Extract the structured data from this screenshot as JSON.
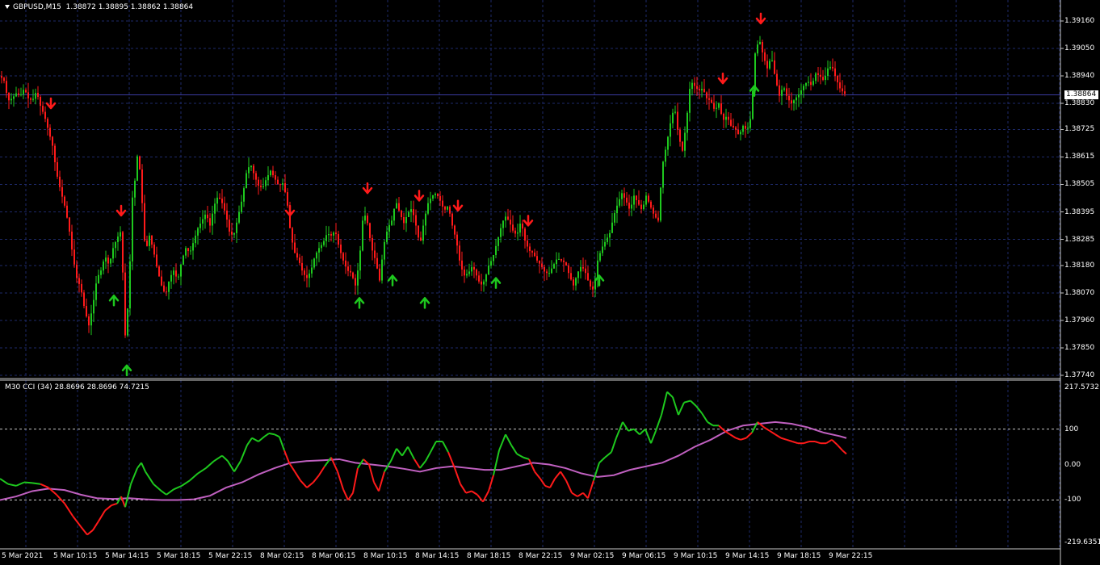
{
  "window": {
    "symbol_title": "GBPUSD,M15",
    "ohlc": "1.38872 1.38895 1.38862 1.38864",
    "current_price": "1.38864"
  },
  "indicator": {
    "label": "M30 CCI (34) 28.8696 28.8696 74.7215",
    "scale_max": "217.5732",
    "scale_min": "-219.6351",
    "levels": [
      "100",
      "0.00",
      "-100"
    ]
  },
  "price_axis": [
    "1.39160",
    "1.39050",
    "1.38940",
    "1.38830",
    "1.38725",
    "1.38615",
    "1.38505",
    "1.38395",
    "1.38285",
    "1.38180",
    "1.38070",
    "1.37960",
    "1.37850",
    "1.37740"
  ],
  "time_axis": [
    "5 Mar 2021",
    "5 Mar 10:15",
    "5 Mar 14:15",
    "5 Mar 18:15",
    "5 Mar 22:15",
    "8 Mar 02:15",
    "8 Mar 06:15",
    "8 Mar 10:15",
    "8 Mar 14:15",
    "8 Mar 18:15",
    "8 Mar 22:15",
    "9 Mar 02:15",
    "9 Mar 06:15",
    "9 Mar 10:15",
    "9 Mar 14:15",
    "9 Mar 18:15",
    "9 Mar 22:15"
  ],
  "colors": {
    "background": "#000000",
    "grid": "#1e2a6a",
    "bull": "#1ec81e",
    "bear": "#ff1a1a",
    "cci_signal": "#c060c0",
    "up_arrow": "#1ec81e",
    "down_arrow": "#ff1a1a"
  },
  "chart_data": {
    "type": "line",
    "price_path": [
      [
        0,
        1.3894
      ],
      [
        5,
        1.3892
      ],
      [
        10,
        1.3884
      ],
      [
        15,
        1.3885
      ],
      [
        20,
        1.3887
      ],
      [
        25,
        1.3886
      ],
      [
        30,
        1.3889
      ],
      [
        35,
        1.3885
      ],
      [
        40,
        1.3884
      ],
      [
        45,
        1.3888
      ],
      [
        50,
        1.3882
      ],
      [
        55,
        1.3878
      ],
      [
        60,
        1.3872
      ],
      [
        65,
        1.3866
      ],
      [
        70,
        1.3855
      ],
      [
        75,
        1.3848
      ],
      [
        80,
        1.3842
      ],
      [
        85,
        1.3834
      ],
      [
        90,
        1.3822
      ],
      [
        95,
        1.3813
      ],
      [
        100,
        1.3809
      ],
      [
        105,
        1.38
      ],
      [
        110,
        1.3794
      ],
      [
        115,
        1.3802
      ],
      [
        120,
        1.3813
      ],
      [
        125,
        1.3816
      ],
      [
        130,
        1.3822
      ],
      [
        135,
        1.3818
      ],
      [
        140,
        1.3825
      ],
      [
        145,
        1.3829
      ],
      [
        150,
        1.3832
      ],
      [
        155,
        1.379
      ],
      [
        160,
        1.3808
      ],
      [
        163,
        1.3843
      ],
      [
        167,
        1.3852
      ],
      [
        171,
        1.3865
      ],
      [
        175,
        1.3848
      ],
      [
        180,
        1.3823
      ],
      [
        185,
        1.383
      ],
      [
        190,
        1.3824
      ],
      [
        195,
        1.3816
      ],
      [
        200,
        1.381
      ],
      [
        205,
        1.3806
      ],
      [
        210,
        1.3813
      ],
      [
        215,
        1.3816
      ],
      [
        220,
        1.3812
      ],
      [
        225,
        1.382
      ],
      [
        230,
        1.3825
      ],
      [
        235,
        1.3823
      ],
      [
        240,
        1.3828
      ],
      [
        245,
        1.3833
      ],
      [
        250,
        1.3836
      ],
      [
        255,
        1.3839
      ],
      [
        260,
        1.3834
      ],
      [
        265,
        1.3842
      ],
      [
        270,
        1.3846
      ],
      [
        275,
        1.3843
      ],
      [
        280,
        1.3838
      ],
      [
        285,
        1.383
      ],
      [
        290,
        1.3831
      ],
      [
        295,
        1.3838
      ],
      [
        300,
        1.3845
      ],
      [
        305,
        1.3855
      ],
      [
        310,
        1.3859
      ],
      [
        315,
        1.3854
      ],
      [
        320,
        1.385
      ],
      [
        325,
        1.3849
      ],
      [
        330,
        1.3853
      ],
      [
        335,
        1.3856
      ],
      [
        340,
        1.3853
      ],
      [
        345,
        1.385
      ],
      [
        350,
        1.3851
      ],
      [
        355,
        1.3845
      ],
      [
        360,
        1.383
      ],
      [
        365,
        1.3823
      ],
      [
        370,
        1.382
      ],
      [
        375,
        1.3815
      ],
      [
        380,
        1.3813
      ],
      [
        385,
        1.3816
      ],
      [
        390,
        1.3822
      ],
      [
        395,
        1.3825
      ],
      [
        400,
        1.3827
      ],
      [
        405,
        1.3831
      ],
      [
        410,
        1.383
      ],
      [
        415,
        1.3832
      ],
      [
        420,
        1.3825
      ],
      [
        425,
        1.382
      ],
      [
        430,
        1.3816
      ],
      [
        435,
        1.3815
      ],
      [
        440,
        1.381
      ],
      [
        445,
        1.382
      ],
      [
        450,
        1.384
      ],
      [
        455,
        1.3835
      ],
      [
        460,
        1.3825
      ],
      [
        465,
        1.382
      ],
      [
        470,
        1.3812
      ],
      [
        475,
        1.3826
      ],
      [
        480,
        1.3833
      ],
      [
        485,
        1.3836
      ],
      [
        490,
        1.3844
      ],
      [
        495,
        1.3839
      ],
      [
        500,
        1.3835
      ],
      [
        505,
        1.3839
      ],
      [
        510,
        1.3841
      ],
      [
        515,
        1.3834
      ],
      [
        520,
        1.3826
      ],
      [
        525,
        1.3836
      ],
      [
        530,
        1.3843
      ],
      [
        535,
        1.3846
      ],
      [
        540,
        1.3847
      ],
      [
        545,
        1.3844
      ],
      [
        550,
        1.384
      ],
      [
        555,
        1.3842
      ],
      [
        560,
        1.3834
      ],
      [
        565,
        1.3828
      ],
      [
        570,
        1.3818
      ],
      [
        575,
        1.3814
      ],
      [
        580,
        1.3815
      ],
      [
        585,
        1.3818
      ],
      [
        590,
        1.3814
      ],
      [
        595,
        1.381
      ],
      [
        600,
        1.3812
      ],
      [
        605,
        1.3818
      ],
      [
        610,
        1.3821
      ],
      [
        615,
        1.3827
      ],
      [
        620,
        1.3833
      ],
      [
        625,
        1.3838
      ],
      [
        630,
        1.3836
      ],
      [
        635,
        1.3832
      ],
      [
        640,
        1.383
      ],
      [
        645,
        1.3836
      ],
      [
        650,
        1.3828
      ],
      [
        655,
        1.3824
      ],
      [
        660,
        1.3823
      ],
      [
        665,
        1.382
      ],
      [
        670,
        1.3818
      ],
      [
        675,
        1.3815
      ],
      [
        680,
        1.3815
      ],
      [
        685,
        1.3818
      ],
      [
        690,
        1.3821
      ],
      [
        695,
        1.382
      ],
      [
        700,
        1.3819
      ],
      [
        705,
        1.3814
      ],
      [
        710,
        1.381
      ],
      [
        715,
        1.3815
      ],
      [
        720,
        1.3818
      ],
      [
        725,
        1.3815
      ],
      [
        730,
        1.381
      ],
      [
        735,
        1.3808
      ],
      [
        740,
        1.382
      ],
      [
        745,
        1.3825
      ],
      [
        750,
        1.3828
      ],
      [
        755,
        1.3831
      ],
      [
        760,
        1.3838
      ],
      [
        765,
        1.3843
      ],
      [
        770,
        1.3847
      ],
      [
        775,
        1.3844
      ],
      [
        780,
        1.384
      ],
      [
        785,
        1.3846
      ],
      [
        790,
        1.3843
      ],
      [
        795,
        1.384
      ],
      [
        800,
        1.3846
      ],
      [
        805,
        1.3842
      ],
      [
        810,
        1.3838
      ],
      [
        815,
        1.3836
      ],
      [
        820,
        1.3858
      ],
      [
        825,
        1.3866
      ],
      [
        830,
        1.3875
      ],
      [
        835,
        1.3882
      ],
      [
        840,
        1.387
      ],
      [
        845,
        1.3864
      ],
      [
        850,
        1.3876
      ],
      [
        855,
        1.3892
      ],
      [
        860,
        1.389
      ],
      [
        865,
        1.3888
      ],
      [
        870,
        1.3889
      ],
      [
        875,
        1.3885
      ],
      [
        880,
        1.3884
      ],
      [
        885,
        1.388
      ],
      [
        890,
        1.3883
      ],
      [
        895,
        1.3876
      ],
      [
        900,
        1.3878
      ],
      [
        905,
        1.3874
      ],
      [
        910,
        1.3873
      ],
      [
        915,
        1.387
      ],
      [
        920,
        1.3874
      ],
      [
        925,
        1.3872
      ],
      [
        930,
        1.3878
      ],
      [
        935,
        1.3903
      ],
      [
        940,
        1.3909
      ],
      [
        945,
        1.3902
      ],
      [
        950,
        1.3897
      ],
      [
        955,
        1.3902
      ],
      [
        960,
        1.3893
      ],
      [
        965,
        1.3886
      ],
      [
        970,
        1.389
      ],
      [
        975,
        1.3885
      ],
      [
        980,
        1.3883
      ],
      [
        985,
        1.3885
      ],
      [
        990,
        1.3887
      ],
      [
        995,
        1.389
      ],
      [
        1000,
        1.3892
      ],
      [
        1005,
        1.389
      ],
      [
        1010,
        1.3895
      ],
      [
        1015,
        1.3894
      ],
      [
        1020,
        1.3892
      ],
      [
        1025,
        1.3897
      ],
      [
        1030,
        1.3898
      ],
      [
        1035,
        1.3893
      ],
      [
        1040,
        1.3889
      ],
      [
        1045,
        1.3887
      ],
      [
        1048,
        1.38864
      ]
    ],
    "price_axis_range": [
      1.3774,
      1.3916
    ],
    "up_arrows": [
      [
        141,
        1.3804
      ],
      [
        157,
        1.3776
      ],
      [
        445,
        1.3803
      ],
      [
        486,
        1.3812
      ],
      [
        526,
        1.3803
      ],
      [
        614,
        1.3811
      ],
      [
        742,
        1.3812
      ],
      [
        934,
        1.3888
      ]
    ],
    "down_arrows": [
      [
        63,
        1.3883
      ],
      [
        150,
        1.384
      ],
      [
        359,
        1.384
      ],
      [
        455,
        1.3849
      ],
      [
        519,
        1.3846
      ],
      [
        567,
        1.3842
      ],
      [
        654,
        1.3836
      ],
      [
        895,
        1.3893
      ],
      [
        942,
        1.3917
      ]
    ],
    "cci_axis_range": [
      -219.6351,
      217.5732
    ],
    "cci_main": [
      [
        0,
        -40
      ],
      [
        10,
        -55
      ],
      [
        20,
        -60
      ],
      [
        30,
        -50
      ],
      [
        40,
        -52
      ],
      [
        50,
        -55
      ],
      [
        60,
        -65
      ],
      [
        70,
        -85
      ],
      [
        80,
        -110
      ],
      [
        90,
        -145
      ],
      [
        100,
        -175
      ],
      [
        108,
        -198
      ],
      [
        115,
        -185
      ],
      [
        122,
        -160
      ],
      [
        130,
        -130
      ],
      [
        138,
        -115
      ],
      [
        145,
        -110
      ],
      [
        150,
        -90
      ],
      [
        155,
        -120
      ],
      [
        162,
        -55
      ],
      [
        170,
        -10
      ],
      [
        175,
        5
      ],
      [
        180,
        -20
      ],
      [
        190,
        -55
      ],
      [
        200,
        -75
      ],
      [
        206,
        -85
      ],
      [
        215,
        -70
      ],
      [
        225,
        -60
      ],
      [
        235,
        -45
      ],
      [
        245,
        -25
      ],
      [
        255,
        -10
      ],
      [
        265,
        10
      ],
      [
        275,
        25
      ],
      [
        282,
        10
      ],
      [
        290,
        -20
      ],
      [
        298,
        10
      ],
      [
        306,
        55
      ],
      [
        312,
        75
      ],
      [
        320,
        65
      ],
      [
        328,
        80
      ],
      [
        333,
        88
      ],
      [
        340,
        85
      ],
      [
        346,
        78
      ],
      [
        352,
        40
      ],
      [
        358,
        5
      ],
      [
        365,
        -20
      ],
      [
        372,
        -45
      ],
      [
        380,
        -65
      ],
      [
        388,
        -50
      ],
      [
        395,
        -30
      ],
      [
        402,
        -5
      ],
      [
        410,
        20
      ],
      [
        418,
        -20
      ],
      [
        425,
        -70
      ],
      [
        431,
        -100
      ],
      [
        437,
        -80
      ],
      [
        443,
        -10
      ],
      [
        450,
        15
      ],
      [
        457,
        0
      ],
      [
        463,
        -50
      ],
      [
        469,
        -75
      ],
      [
        476,
        -20
      ],
      [
        484,
        10
      ],
      [
        491,
        45
      ],
      [
        498,
        25
      ],
      [
        505,
        50
      ],
      [
        513,
        15
      ],
      [
        520,
        -10
      ],
      [
        527,
        10
      ],
      [
        533,
        35
      ],
      [
        540,
        65
      ],
      [
        548,
        65
      ],
      [
        555,
        35
      ],
      [
        563,
        -10
      ],
      [
        570,
        -55
      ],
      [
        577,
        -80
      ],
      [
        584,
        -75
      ],
      [
        591,
        -85
      ],
      [
        598,
        -105
      ],
      [
        605,
        -75
      ],
      [
        611,
        -30
      ],
      [
        618,
        40
      ],
      [
        626,
        85
      ],
      [
        633,
        55
      ],
      [
        640,
        30
      ],
      [
        648,
        20
      ],
      [
        655,
        15
      ],
      [
        662,
        -20
      ],
      [
        669,
        -40
      ],
      [
        675,
        -60
      ],
      [
        681,
        -65
      ],
      [
        687,
        -40
      ],
      [
        694,
        -20
      ],
      [
        701,
        -45
      ],
      [
        708,
        -80
      ],
      [
        715,
        -90
      ],
      [
        722,
        -80
      ],
      [
        728,
        -95
      ],
      [
        735,
        -45
      ],
      [
        742,
        5
      ],
      [
        749,
        20
      ],
      [
        757,
        35
      ],
      [
        763,
        75
      ],
      [
        771,
        120
      ],
      [
        778,
        95
      ],
      [
        785,
        100
      ],
      [
        792,
        85
      ],
      [
        799,
        100
      ],
      [
        806,
        60
      ],
      [
        812,
        95
      ],
      [
        819,
        140
      ],
      [
        826,
        205
      ],
      [
        833,
        190
      ],
      [
        840,
        140
      ],
      [
        847,
        175
      ],
      [
        855,
        180
      ],
      [
        862,
        165
      ],
      [
        869,
        145
      ],
      [
        876,
        120
      ],
      [
        883,
        110
      ],
      [
        890,
        110
      ],
      [
        897,
        95
      ],
      [
        904,
        85
      ],
      [
        911,
        75
      ],
      [
        917,
        70
      ],
      [
        924,
        75
      ],
      [
        931,
        90
      ],
      [
        938,
        120
      ],
      [
        946,
        105
      ],
      [
        953,
        95
      ],
      [
        960,
        85
      ],
      [
        967,
        75
      ],
      [
        974,
        70
      ],
      [
        981,
        65
      ],
      [
        988,
        60
      ],
      [
        995,
        60
      ],
      [
        1002,
        65
      ],
      [
        1009,
        65
      ],
      [
        1016,
        60
      ],
      [
        1023,
        60
      ],
      [
        1030,
        70
      ],
      [
        1037,
        55
      ],
      [
        1043,
        40
      ],
      [
        1048,
        30
      ]
    ],
    "cci_signal": [
      [
        0,
        -100
      ],
      [
        20,
        -90
      ],
      [
        40,
        -75
      ],
      [
        60,
        -68
      ],
      [
        80,
        -72
      ],
      [
        100,
        -85
      ],
      [
        120,
        -95
      ],
      [
        140,
        -97
      ],
      [
        160,
        -95
      ],
      [
        180,
        -98
      ],
      [
        200,
        -100
      ],
      [
        220,
        -100
      ],
      [
        240,
        -98
      ],
      [
        260,
        -88
      ],
      [
        280,
        -65
      ],
      [
        300,
        -50
      ],
      [
        320,
        -28
      ],
      [
        340,
        -10
      ],
      [
        360,
        5
      ],
      [
        380,
        10
      ],
      [
        400,
        12
      ],
      [
        420,
        15
      ],
      [
        440,
        5
      ],
      [
        460,
        0
      ],
      [
        480,
        -5
      ],
      [
        500,
        -12
      ],
      [
        520,
        -20
      ],
      [
        540,
        -10
      ],
      [
        560,
        -5
      ],
      [
        580,
        -10
      ],
      [
        600,
        -15
      ],
      [
        620,
        -15
      ],
      [
        640,
        -5
      ],
      [
        660,
        5
      ],
      [
        680,
        0
      ],
      [
        700,
        -10
      ],
      [
        720,
        -25
      ],
      [
        740,
        -35
      ],
      [
        760,
        -30
      ],
      [
        780,
        -15
      ],
      [
        800,
        -5
      ],
      [
        820,
        5
      ],
      [
        840,
        25
      ],
      [
        860,
        50
      ],
      [
        880,
        70
      ],
      [
        900,
        95
      ],
      [
        920,
        110
      ],
      [
        940,
        115
      ],
      [
        960,
        120
      ],
      [
        980,
        115
      ],
      [
        1000,
        105
      ],
      [
        1020,
        90
      ],
      [
        1040,
        80
      ],
      [
        1048,
        74.7
      ]
    ]
  }
}
